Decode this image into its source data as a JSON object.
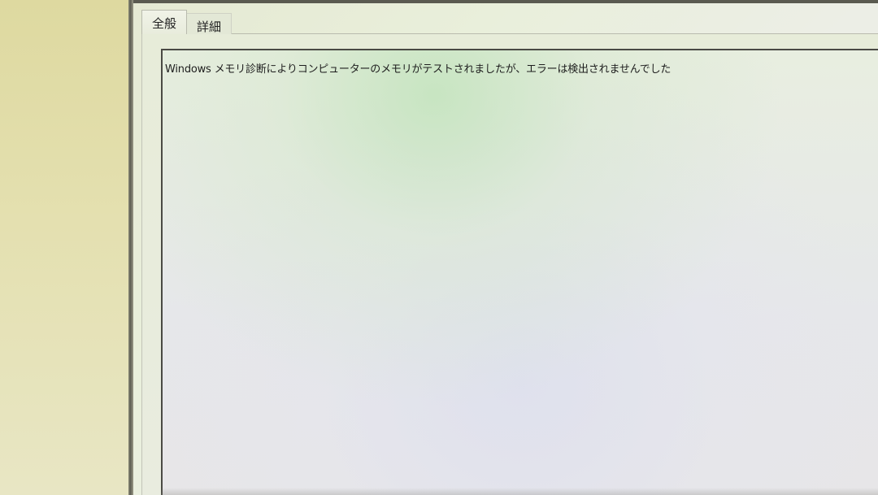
{
  "tabs": [
    {
      "label": "全般",
      "active": true
    },
    {
      "label": "詳細",
      "active": false
    }
  ],
  "message": {
    "text": "Windows メモリ診断によりコンピューターのメモリがテストされましたが、エラーは検出されませんでした"
  },
  "colors": {
    "window_background": "#e9ecdf",
    "text": "#1e1e1e",
    "border": "#4a4a44"
  }
}
